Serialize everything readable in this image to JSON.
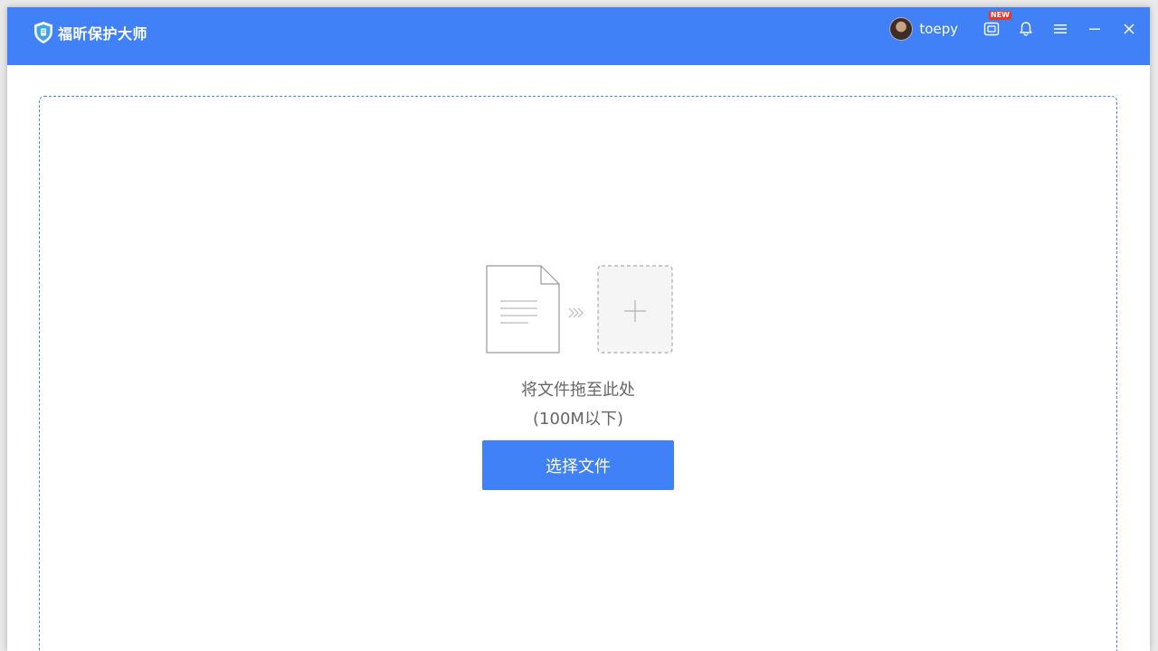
{
  "app": {
    "title": "福昕保护大师"
  },
  "user": {
    "name": "toepy"
  },
  "titlebar_icons": {
    "badge_text": "NEW",
    "icons": [
      "shield-logo-icon",
      "avatar",
      "promo-icon",
      "bell-icon",
      "menu-icon",
      "minimize-icon",
      "close-icon"
    ]
  },
  "dropzone": {
    "hint": "将文件拖至此处",
    "limit": "(100M以下)",
    "button_label": "选择文件"
  },
  "colors": {
    "accent": "#4081f7",
    "dashed_border": "#4a86e8",
    "badge": "#e8382f",
    "hint_text": "#666666"
  }
}
